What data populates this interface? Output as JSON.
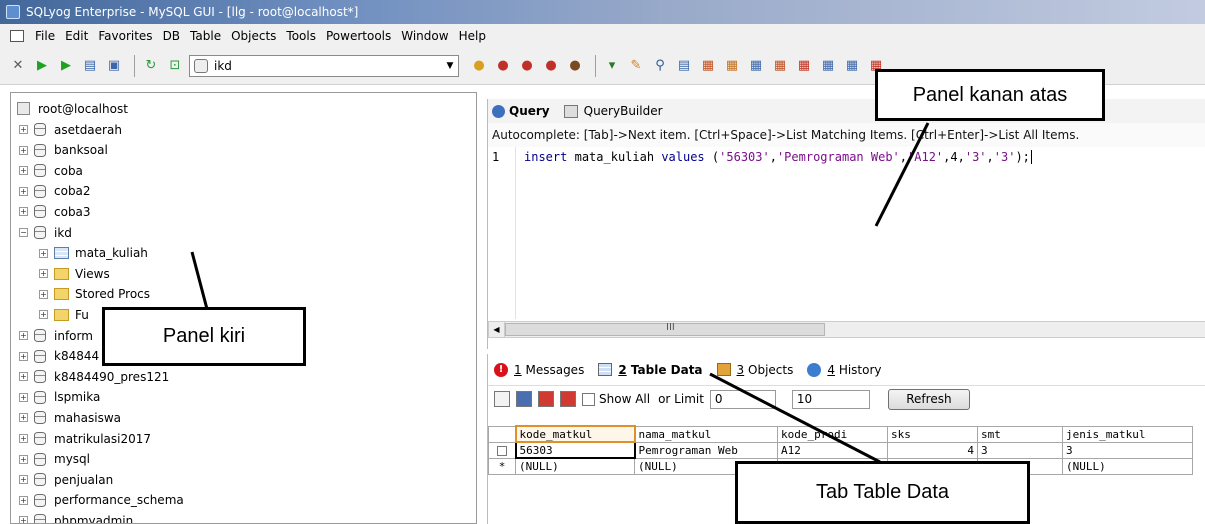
{
  "window": {
    "title": "SQLyog Enterprise - MySQL GUI - [llg - root@localhost*]"
  },
  "menu": [
    "File",
    "Edit",
    "Favorites",
    "DB",
    "Table",
    "Objects",
    "Tools",
    "Powertools",
    "Window",
    "Help"
  ],
  "toolbar": {
    "database_selector": "ikd"
  },
  "tree": {
    "root": "root@localhost",
    "items": [
      {
        "label": "asetdaerah",
        "kind": "db",
        "indent": 0,
        "expanded": false
      },
      {
        "label": "banksoal",
        "kind": "db",
        "indent": 0,
        "expanded": false
      },
      {
        "label": "coba",
        "kind": "db",
        "indent": 0,
        "expanded": false
      },
      {
        "label": "coba2",
        "kind": "db",
        "indent": 0,
        "expanded": false
      },
      {
        "label": "coba3",
        "kind": "db",
        "indent": 0,
        "expanded": false
      },
      {
        "label": "ikd",
        "kind": "db",
        "indent": 0,
        "expanded": true
      },
      {
        "label": "mata_kuliah",
        "kind": "table",
        "indent": 1,
        "expanded": false
      },
      {
        "label": "Views",
        "kind": "folder",
        "indent": 1,
        "expanded": false
      },
      {
        "label": "Stored Procs",
        "kind": "folder",
        "indent": 1,
        "expanded": false
      },
      {
        "label": "Fu",
        "kind": "folder",
        "indent": 1,
        "expanded": false
      },
      {
        "label": "inform",
        "kind": "db",
        "indent": 0,
        "expanded": false
      },
      {
        "label": "k84844",
        "kind": "db",
        "indent": 0,
        "expanded": false
      },
      {
        "label": "k8484490_pres121",
        "kind": "db",
        "indent": 0,
        "expanded": false
      },
      {
        "label": "lspmika",
        "kind": "db",
        "indent": 0,
        "expanded": false
      },
      {
        "label": "mahasiswa",
        "kind": "db",
        "indent": 0,
        "expanded": false
      },
      {
        "label": "matrikulasi2017",
        "kind": "db",
        "indent": 0,
        "expanded": false
      },
      {
        "label": "mysql",
        "kind": "db",
        "indent": 0,
        "expanded": false
      },
      {
        "label": "penjualan",
        "kind": "db",
        "indent": 0,
        "expanded": false
      },
      {
        "label": "performance_schema",
        "kind": "db",
        "indent": 0,
        "expanded": false
      },
      {
        "label": "phpmyadmin",
        "kind": "db",
        "indent": 0,
        "expanded": false
      }
    ]
  },
  "query_tabs": {
    "query": "Query",
    "builder": "QueryBuilder"
  },
  "autocomplete_hint": "Autocomplete: [Tab]->Next item. [Ctrl+Space]->List Matching Items. [Ctrl+Enter]->List All Items.",
  "editor": {
    "line_number": "1",
    "kw1": "insert",
    "table": "mata_kuliah",
    "kw2": "values",
    "open": "(",
    "v1": "'56303'",
    "v2": "'Pemrograman Web'",
    "v3": "'A12'",
    "v4": "4",
    "v5": "'3'",
    "v6": "'3'",
    "close": ");",
    "sep": ","
  },
  "result_tabs": [
    {
      "num": "1",
      "label": "Messages"
    },
    {
      "num": "2",
      "label": "Table Data"
    },
    {
      "num": "3",
      "label": "Objects"
    },
    {
      "num": "4",
      "label": "History"
    }
  ],
  "rowtools": {
    "show_all": "Show All",
    "or_limit": "or Limit",
    "offset": "0",
    "limit": "10",
    "refresh": "Refresh"
  },
  "table": {
    "columns": [
      "kode_matkul",
      "nama_matkul",
      "kode_prodi",
      "sks",
      "smt",
      "jenis_matkul"
    ],
    "rows": [
      [
        "56303",
        "Pemrograman Web",
        "A12",
        "4",
        "3",
        "3"
      ],
      [
        "(NULL)",
        "(NULL)",
        "",
        "",
        "",
        "(NULL)"
      ]
    ],
    "row_marker": "*"
  },
  "annotations": {
    "top_right": "Panel kanan atas",
    "left": "Panel kiri",
    "table_data": "Tab Table Data"
  },
  "colors": {
    "titlebar_start": "#43679a",
    "active_header": "#e0902b",
    "messages_icon": "#d8121a"
  }
}
